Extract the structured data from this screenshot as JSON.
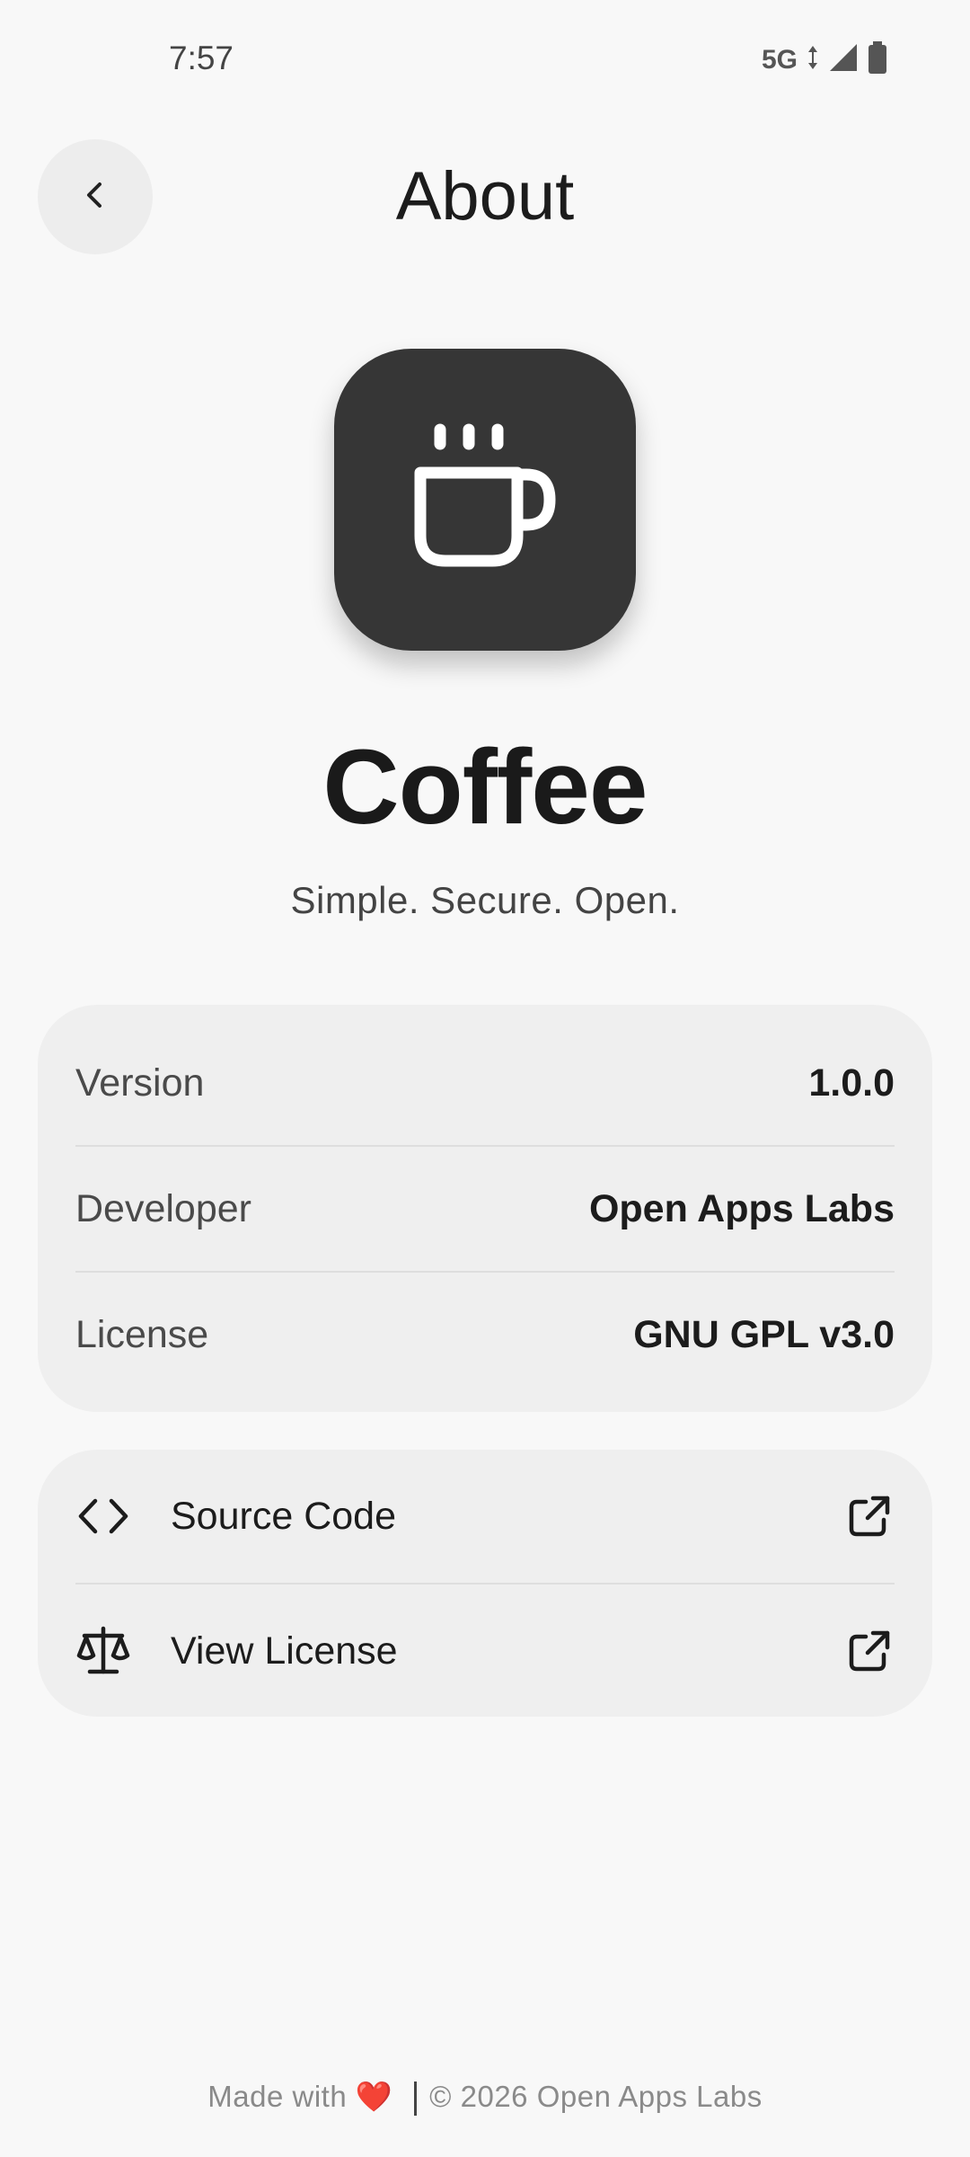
{
  "status_bar": {
    "time": "7:57",
    "network": "5G",
    "icons": [
      "signal-icon",
      "battery-icon"
    ]
  },
  "header": {
    "title": "About",
    "back_icon": "chevron-left-icon"
  },
  "app": {
    "icon": "coffee-cup-icon",
    "name": "Coffee",
    "tagline": "Simple. Secure. Open."
  },
  "info": [
    {
      "label": "Version",
      "value": "1.0.0"
    },
    {
      "label": "Developer",
      "value": "Open Apps Labs"
    },
    {
      "label": "License",
      "value": "GNU GPL v3.0"
    }
  ],
  "links": [
    {
      "label": "Source Code",
      "icon": "code-icon",
      "trailing_icon": "external-link-icon"
    },
    {
      "label": "View License",
      "icon": "scale-icon",
      "trailing_icon": "external-link-icon"
    }
  ],
  "footer": {
    "made_with": "Made with",
    "heart": "❤️",
    "copyright": "© 2026 Open Apps Labs"
  },
  "colors": {
    "background": "#f8f8f8",
    "card": "#efefef",
    "app_icon_bg": "#363636",
    "heart": "#ef6c6c"
  }
}
